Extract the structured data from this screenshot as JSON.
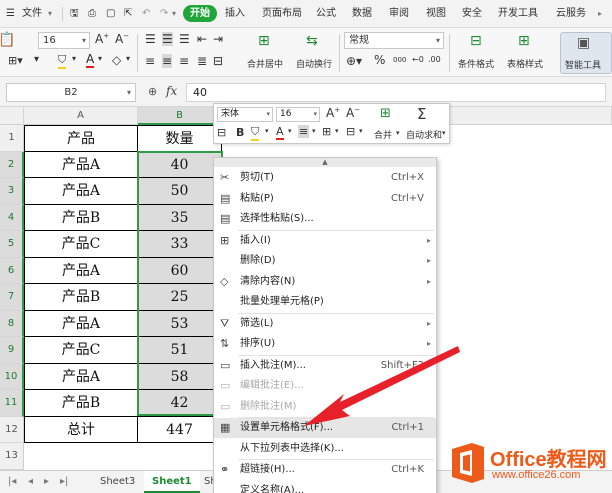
{
  "menubar": {
    "file": "文件",
    "tabs": [
      "开始",
      "插入",
      "页面布局",
      "公式",
      "数据",
      "审阅",
      "视图",
      "安全",
      "开发工具",
      "云服务"
    ],
    "active_tab": "开始"
  },
  "ribbon": {
    "font_size": "16",
    "merge_center": "合并居中",
    "wrap_text": "自动换行",
    "number_format": "常规",
    "cond_format": "条件格式",
    "table_style": "表格样式",
    "smart_tool": "智能工具",
    "percent": "%",
    "thousands": "000"
  },
  "formula": {
    "name_box": "B2",
    "fx": "fx",
    "value": "40"
  },
  "columns": [
    "A",
    "B",
    "C"
  ],
  "rows": [
    "1",
    "2",
    "3",
    "4",
    "5",
    "6",
    "7",
    "8",
    "9",
    "10",
    "11",
    "12",
    "13"
  ],
  "table": {
    "header": [
      "产品",
      "数量"
    ],
    "data": [
      [
        "产品A",
        "40"
      ],
      [
        "产品A",
        "50"
      ],
      [
        "产品B",
        "35"
      ],
      [
        "产品C",
        "33"
      ],
      [
        "产品A",
        "60"
      ],
      [
        "产品B",
        "25"
      ],
      [
        "产品A",
        "53"
      ],
      [
        "产品C",
        "51"
      ],
      [
        "产品A",
        "58"
      ],
      [
        "产品B",
        "42"
      ]
    ],
    "total": [
      "总计",
      "447"
    ]
  },
  "mini_toolbar": {
    "font": "宋体",
    "size": "16",
    "bold": "B",
    "merge": "合并",
    "autosum": "自动求和"
  },
  "context_menu": {
    "items": [
      {
        "label": "剪切(T)",
        "shortcut": "Ctrl+X",
        "icon": "scissors-icon"
      },
      {
        "label": "粘贴(P)",
        "shortcut": "Ctrl+V",
        "icon": "paste-icon"
      },
      {
        "label": "选择性粘贴(S)...",
        "shortcut": "",
        "icon": "paste-special-icon"
      },
      {
        "label": "插入(I)",
        "shortcut": "",
        "icon": "insert-icon",
        "submenu": true
      },
      {
        "label": "删除(D)",
        "shortcut": "",
        "icon": "",
        "submenu": true
      },
      {
        "label": "清除内容(N)",
        "shortcut": "",
        "icon": "eraser-icon",
        "submenu": true
      },
      {
        "label": "批量处理单元格(P)",
        "shortcut": "",
        "icon": ""
      },
      {
        "label": "筛选(L)",
        "shortcut": "",
        "icon": "filter-icon",
        "submenu": true
      },
      {
        "label": "排序(U)",
        "shortcut": "",
        "icon": "sort-icon",
        "submenu": true
      },
      {
        "label": "插入批注(M)...",
        "shortcut": "Shift+F2",
        "icon": "comment-icon"
      },
      {
        "label": "编辑批注(E)...",
        "shortcut": "",
        "icon": "edit-comment-icon",
        "disabled": true
      },
      {
        "label": "删除批注(M)",
        "shortcut": "",
        "icon": "delete-comment-icon",
        "disabled": true
      },
      {
        "label": "设置单元格格式(F)...",
        "shortcut": "Ctrl+1",
        "icon": "format-cells-icon",
        "highlighted": true
      },
      {
        "label": "从下拉列表中选择(K)...",
        "shortcut": "",
        "icon": ""
      },
      {
        "label": "超链接(H)...",
        "shortcut": "Ctrl+K",
        "icon": "link-icon"
      },
      {
        "label": "定义名称(A)...",
        "shortcut": "",
        "icon": ""
      }
    ]
  },
  "sheets": {
    "tabs": [
      "Sheet3",
      "Sheet1",
      "Sh"
    ],
    "active": "Sheet1"
  },
  "logo": {
    "title": "Office教程网",
    "url": "www.office26.com"
  },
  "colors": {
    "accent": "#20a53a",
    "selection": "#2f9a47",
    "arrow": "#e8202a",
    "logo": "#ee5a1a"
  }
}
